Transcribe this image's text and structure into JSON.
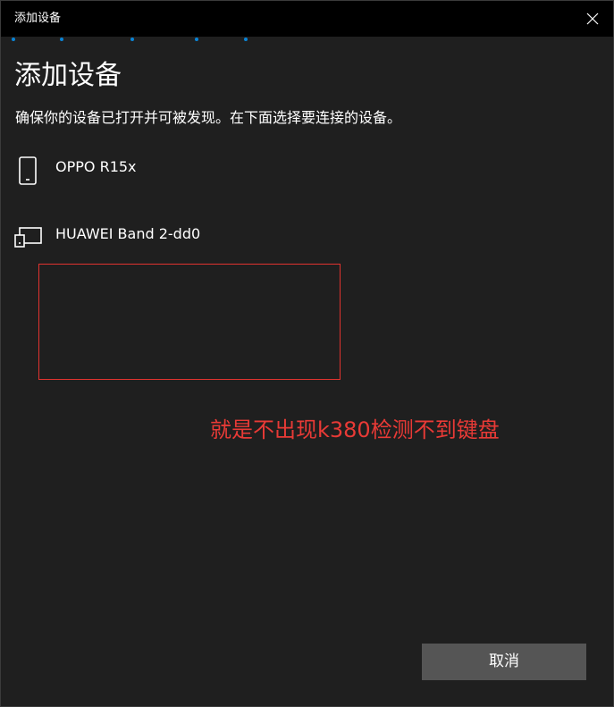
{
  "window": {
    "title": "添加设备",
    "close_icon": "close-icon"
  },
  "main": {
    "heading": "添加设备",
    "subtitle": "确保你的设备已打开并可被发现。在下面选择要连接的设备。",
    "devices": [
      {
        "name": "OPPO R15x",
        "icon": "phone-icon"
      },
      {
        "name": "HUAWEI Band 2-dd0",
        "icon": "display-device-icon"
      }
    ]
  },
  "annotation": {
    "text": "就是不出现k380检测不到键盘",
    "color": "#e83a36"
  },
  "footer": {
    "cancel_label": "取消"
  },
  "colors": {
    "accent": "#0a84d6",
    "background": "#1f1f1f",
    "titlebar": "#000000",
    "button": "#555555",
    "highlight_border": "#e0332f"
  }
}
